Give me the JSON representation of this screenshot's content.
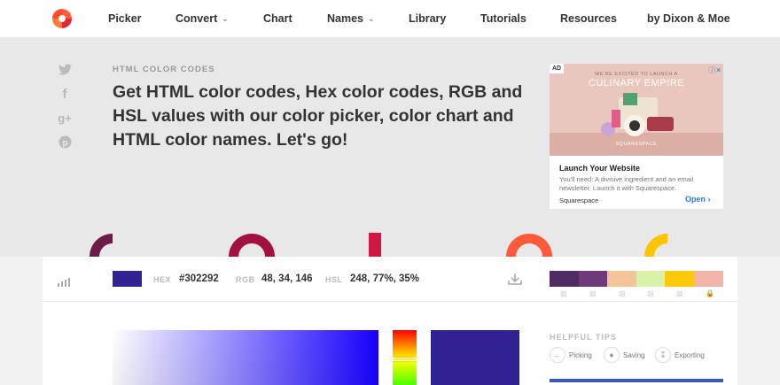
{
  "nav": {
    "items": [
      {
        "label": "Picker",
        "has_caret": false
      },
      {
        "label": "Convert",
        "has_caret": true
      },
      {
        "label": "Chart",
        "has_caret": false
      },
      {
        "label": "Names",
        "has_caret": true
      },
      {
        "label": "Library",
        "has_caret": false
      },
      {
        "label": "Tutorials",
        "has_caret": false
      },
      {
        "label": "Resources",
        "has_caret": false
      },
      {
        "label": "by Dixon & Moe",
        "has_caret": false
      }
    ]
  },
  "social": [
    "twitter-icon",
    "facebook-icon",
    "google-plus-icon",
    "pinterest-icon"
  ],
  "hero": {
    "eyebrow": "HTML COLOR CODES",
    "headline": "Get HTML color codes, Hex color codes, RGB and HSL values with our color picker, color chart and HTML color names. Let's go!"
  },
  "ad": {
    "tag": "AD",
    "image_eyebrow": "WE'RE EXCITED TO LAUNCH A",
    "image_brand": "CULINARY EMPIRE",
    "image_footer": "SQUARESPACE",
    "title": "Launch Your Website",
    "text": "You'll need: A divisive ingredient and an email newsletter. Launch it with Squarespace.",
    "source": "Squarespace",
    "cta": "Open"
  },
  "decor_colors": [
    "#6b1d47",
    "#a3123f",
    "#d01847",
    "#ff5b3b",
    "#ffc400"
  ],
  "picker": {
    "color_hex": "#302292",
    "hex_label": "HEX",
    "hex_value": "#302292",
    "rgb_label": "RGB",
    "rgb_value": "48, 34, 146",
    "hsl_label": "HSL",
    "hsl_value": "248, 77%, 35%"
  },
  "palette": [
    "#4f2d63",
    "#6e3a7b",
    "#f4c399",
    "#d8f2a9",
    "#ffc90c",
    "#f3b5a8"
  ],
  "tips": {
    "title": "HELPFUL TIPS",
    "items": [
      {
        "label": "Picking",
        "icon": "arrow-left-icon"
      },
      {
        "label": "Saving",
        "icon": "lock-icon"
      },
      {
        "label": "Exporting",
        "icon": "download-icon"
      }
    ]
  }
}
